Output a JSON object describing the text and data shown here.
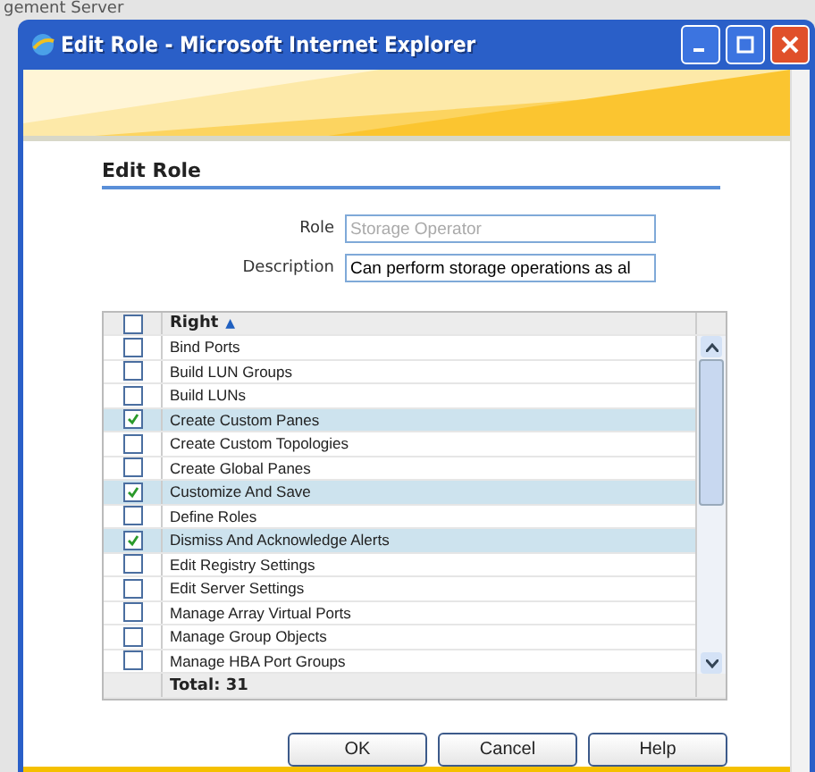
{
  "background_title": "gement Server",
  "window": {
    "title": "Edit Role - Microsoft Internet Explorer"
  },
  "heading": "Edit Role",
  "form": {
    "role": {
      "label": "Role",
      "value": "Storage Operator",
      "disabled": true
    },
    "description": {
      "label": "Description",
      "value": "Can perform storage operations as al"
    }
  },
  "table": {
    "header_checked": false,
    "column": "Right",
    "sort": "▲",
    "rows": [
      {
        "right": "Bind Ports",
        "checked": false
      },
      {
        "right": "Build LUN Groups",
        "checked": false
      },
      {
        "right": "Build LUNs",
        "checked": false
      },
      {
        "right": "Create Custom Panes",
        "checked": true
      },
      {
        "right": "Create Custom Topologies",
        "checked": false
      },
      {
        "right": "Create Global Panes",
        "checked": false
      },
      {
        "right": "Customize And Save",
        "checked": true
      },
      {
        "right": "Define Roles",
        "checked": false
      },
      {
        "right": "Dismiss And Acknowledge Alerts",
        "checked": true
      },
      {
        "right": "Edit Registry Settings",
        "checked": false
      },
      {
        "right": "Edit Server Settings",
        "checked": false
      },
      {
        "right": "Manage Array Virtual Ports",
        "checked": false
      },
      {
        "right": "Manage Group Objects",
        "checked": false
      },
      {
        "right": "Manage HBA Port Groups",
        "checked": false
      }
    ],
    "total": "Total: 31"
  },
  "buttons": [
    "OK",
    "Cancel",
    "Help"
  ]
}
